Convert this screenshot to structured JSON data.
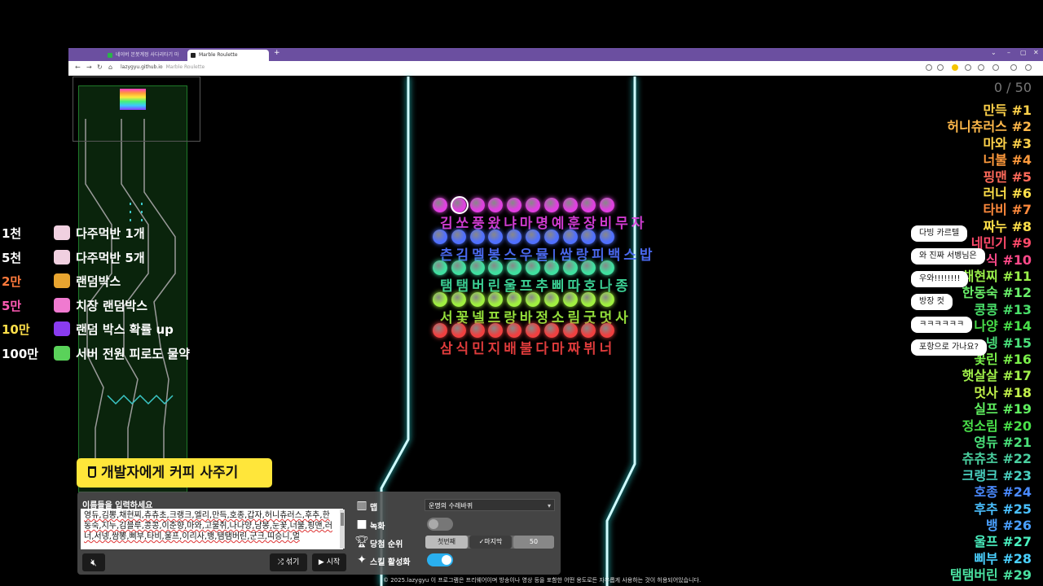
{
  "browser": {
    "tabs": [
      {
        "label": "네이버 본봇계정 사다리타기 마"
      },
      {
        "label": "Marble Roulette"
      }
    ],
    "new_tab": "+",
    "url": "lazygyu.github.io",
    "page_title": "Marble Roulette",
    "accent": "#6b4fa0"
  },
  "donations": [
    {
      "amount": "1천",
      "label": "다주먹반 1개",
      "color": "#ffffff",
      "icon_color": "#f0d0e0",
      "icon": "cat-face-icon"
    },
    {
      "amount": "5천",
      "label": "다주먹반 5개",
      "color": "#ffffff",
      "icon_color": "#f0d0e0",
      "icon": "cat-face-icon"
    },
    {
      "amount": "2만",
      "label": "랜덤박스",
      "color": "#ff7a3c",
      "icon_color": "#e8a530",
      "icon": "box-icon"
    },
    {
      "amount": "5만",
      "label": "치장 랜덤박스",
      "color": "#ff5ab4",
      "icon_color": "#f07ad0",
      "icon": "box-icon"
    },
    {
      "amount": "10만",
      "label": "랜덤 박스 확률 up",
      "color": "#ffe04a",
      "icon_color": "#8a3cf0",
      "icon": "box-icon"
    },
    {
      "amount": "100만",
      "label": "서버 전원 피로도 물약",
      "color": "#ffffff",
      "icon_color": "#5ad25a",
      "icon": "potion-icon"
    }
  ],
  "coffee_label": "개발자에게 커피 사주기",
  "panel": {
    "names_label": "이름들을 입력하세요",
    "names_value": "영듀,김뽕,채현찌,츄츄초,크랭크,엘리,만득,호종,갑자,허니츄러스,후추,한동숙,지누,김블루,콩콩,이춘향,마와,고물쥐,나나양,남봉,눈꽃,너불,핑맨,러너,서넹,쌈뽕,삐부,타비,울프,이리사,뱅,탬탬버린,군크,띠승니,멀",
    "shuffle_label": "섞기",
    "start_label": "시작",
    "map_label": "맵",
    "map_value": "운명의 수레바퀴",
    "record_label": "녹화",
    "rank_label": "당첨 순위",
    "rank_first": "첫번째",
    "rank_last": "✓마지막",
    "rank_number": "50",
    "skill_label": "스킬 활성화",
    "record_on": false,
    "skill_on": true
  },
  "copyright": "© 2025.lazygyu 이 프로그램은 프리웨어이며 방송이나 영상 등을 포함한 어떤 용도로든 자유롭게 사용하는 것이 허용되어있습니다.",
  "game": {
    "marble_rows": [
      {
        "color": "#e040e0",
        "count": 10,
        "label": "김 쏘 풍 왔 냐 마 명 예 훈 장 비 무 자"
      },
      {
        "color": "#5070ff",
        "count": 10,
        "label": "츤 김 멜 봉 스 우 뮬 | 쌈 랑 피 백 스 밥"
      },
      {
        "color": "#40e0a0",
        "count": 10,
        "label": "탬 탬 버 린 울 프 추 삐 따 호 나 종"
      },
      {
        "color": "#a0f040",
        "count": 10,
        "label": "서 꽃 넬 프 랑 바 정 소 림 굿 멋 사"
      },
      {
        "color": "#f04040",
        "count": 10,
        "label": "삼 식 민 지 배 불 다 마 짜 뷔 너"
      }
    ]
  },
  "ranking": {
    "count": "0 / 50",
    "items": [
      {
        "name": "만득 #1",
        "color": "#ffd24a"
      },
      {
        "name": "허니츄러스 #2",
        "color": "#ffb84a"
      },
      {
        "name": "마와 #3",
        "color": "#ffd24a"
      },
      {
        "name": "너불 #4",
        "color": "#ff9a3c"
      },
      {
        "name": "핑맨 #5",
        "color": "#ff6a5a"
      },
      {
        "name": "러너 #6",
        "color": "#ffe04a"
      },
      {
        "name": "타비 #7",
        "color": "#ff8a3c"
      },
      {
        "name": "짜누 #8",
        "color": "#ffe04a"
      },
      {
        "name": "네민기 #9",
        "color": "#ff4a6a"
      },
      {
        "name": "식 #10",
        "color": "#ff4a8a"
      },
      {
        "name": "채현찌 #11",
        "color": "#9af04a"
      },
      {
        "name": "한동숙 #12",
        "color": "#6af06a"
      },
      {
        "name": "콩콩 #13",
        "color": "#4ae06a"
      },
      {
        "name": "나양 #14",
        "color": "#4ae04a"
      },
      {
        "name": "넹 #15",
        "color": "#4ae07a"
      },
      {
        "name": "꽃린 #16",
        "color": "#7af04a"
      },
      {
        "name": "햇살살 #17",
        "color": "#a0f04a"
      },
      {
        "name": "멋사 #18",
        "color": "#c0f04a"
      },
      {
        "name": "실프 #19",
        "color": "#60f060"
      },
      {
        "name": "정소림 #20",
        "color": "#4ae04a"
      },
      {
        "name": "영듀 #21",
        "color": "#4ae07a"
      },
      {
        "name": "츄츄초 #22",
        "color": "#4ad0a0"
      },
      {
        "name": "크랭크 #23",
        "color": "#4ad0c0"
      },
      {
        "name": "호종 #24",
        "color": "#4a8aff"
      },
      {
        "name": "후추 #25",
        "color": "#4ac0ff"
      },
      {
        "name": "뱅 #26",
        "color": "#4aa0ff"
      },
      {
        "name": "울프 #27",
        "color": "#4af0c0"
      },
      {
        "name": "삐부 #28",
        "color": "#4ad0ff"
      },
      {
        "name": "탬탬버린 #29",
        "color": "#4ae0a0"
      }
    ]
  },
  "chat": [
    {
      "text": "다빙 카르텔"
    },
    {
      "text": "와 진짜 서벵님은"
    },
    {
      "text": "우와!!!!!!!!"
    },
    {
      "text": "방장 컷"
    },
    {
      "text": "ㅋㅋㅋㅋㅋㅋ"
    },
    {
      "text": "포항으로 가나요?"
    }
  ]
}
